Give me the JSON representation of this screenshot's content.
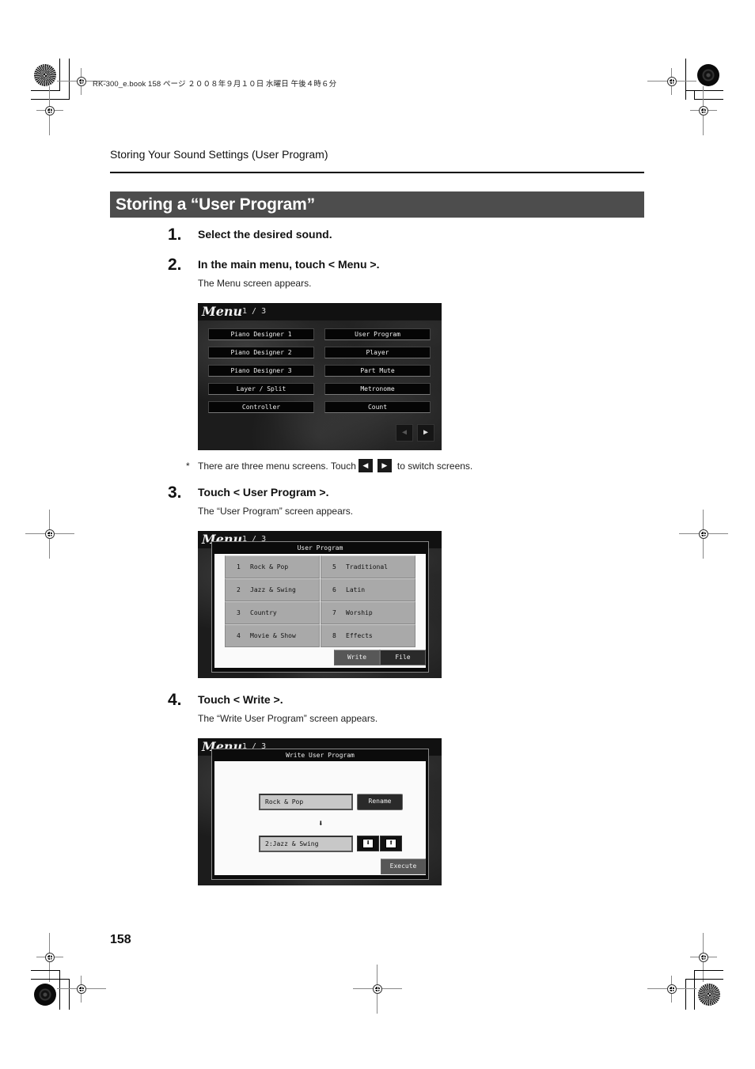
{
  "print_header": "RK-300_e.book  158 ページ  ２００８年９月１０日  水曜日  午後４時６分",
  "running_head": "Storing Your Sound Settings (User Program)",
  "section_title": "Storing a “User Program”",
  "steps": [
    {
      "number": "1.",
      "title": "Select the desired sound."
    },
    {
      "number": "2.",
      "title": "In the main menu, touch < Menu >.",
      "note": "The Menu screen appears."
    },
    {
      "number": "3.",
      "title": "Touch < User Program >.",
      "note": "The “User Program” screen appears."
    },
    {
      "number": "4.",
      "title": "Touch < Write >.",
      "note": "The “Write User Program” screen appears."
    }
  ],
  "footnote": {
    "marker": "*",
    "before": "There are three menu screens. Touch",
    "prev_icon": "◀",
    "next_icon": "▶",
    "after": "to switch screens."
  },
  "menu_screen": {
    "logo": "Menu",
    "page": "1 / 3",
    "left_buttons": [
      "Piano Designer 1",
      "Piano Designer 2",
      "Piano Designer 3",
      "Layer / Split",
      "Controller"
    ],
    "right_buttons": [
      "User Program",
      "Player",
      "Part Mute",
      "Metronome",
      "Count"
    ],
    "prev_icon": "◀",
    "next_icon": "▶"
  },
  "user_program_screen": {
    "title": "User Program",
    "programs": [
      {
        "num": "1",
        "name": "Rock & Pop"
      },
      {
        "num": "2",
        "name": "Jazz & Swing"
      },
      {
        "num": "3",
        "name": "Country"
      },
      {
        "num": "4",
        "name": "Movie & Show"
      },
      {
        "num": "5",
        "name": "Traditional"
      },
      {
        "num": "6",
        "name": "Latin"
      },
      {
        "num": "7",
        "name": "Worship"
      },
      {
        "num": "8",
        "name": "Effects"
      }
    ],
    "write_label": "Write",
    "file_label": "File"
  },
  "write_screen": {
    "title": "Write User Program",
    "source_value": "Rock & Pop",
    "rename_label": "Rename",
    "arrow_icon": "⬇",
    "dest_value": "2:Jazz & Swing",
    "down_icon": "⬇",
    "up_icon": "⬆",
    "execute_label": "Execute"
  },
  "page_number": "158"
}
